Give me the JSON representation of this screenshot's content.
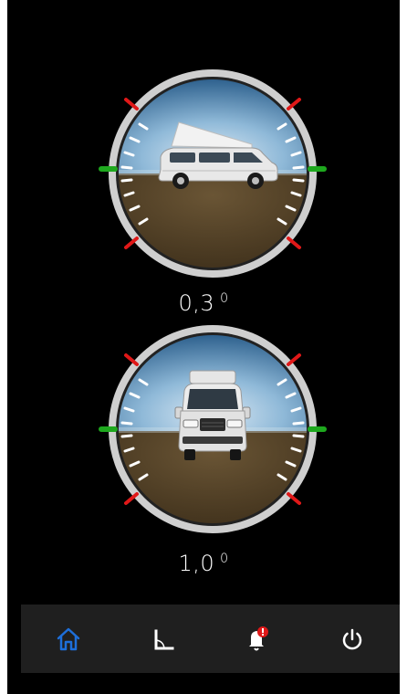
{
  "app": {
    "screen": "leveling"
  },
  "gauges": [
    {
      "id": "side",
      "view": "side-view",
      "value": "0,3",
      "unit": "0",
      "tilt_degrees": 0.3
    },
    {
      "id": "front",
      "view": "front-view",
      "value": "1,0",
      "unit": "0",
      "tilt_degrees": 1.0
    }
  ],
  "navbar": {
    "items": [
      {
        "name": "home",
        "icon": "home-icon",
        "active": true
      },
      {
        "name": "level",
        "icon": "level-angle-icon",
        "active": false
      },
      {
        "name": "alerts",
        "icon": "bell-icon",
        "active": false,
        "badge": "!"
      },
      {
        "name": "power",
        "icon": "power-icon",
        "active": false
      }
    ]
  },
  "colors": {
    "sky_top": "#2e6f9e",
    "sky_bottom": "#9ec4e0",
    "ground": "#4a3a22",
    "ring": "#c8c8c8",
    "accent_active": "#1e6fd9",
    "level_mark": "#1ea81e",
    "limit_mark": "#e01818",
    "badge": "#e01818"
  }
}
